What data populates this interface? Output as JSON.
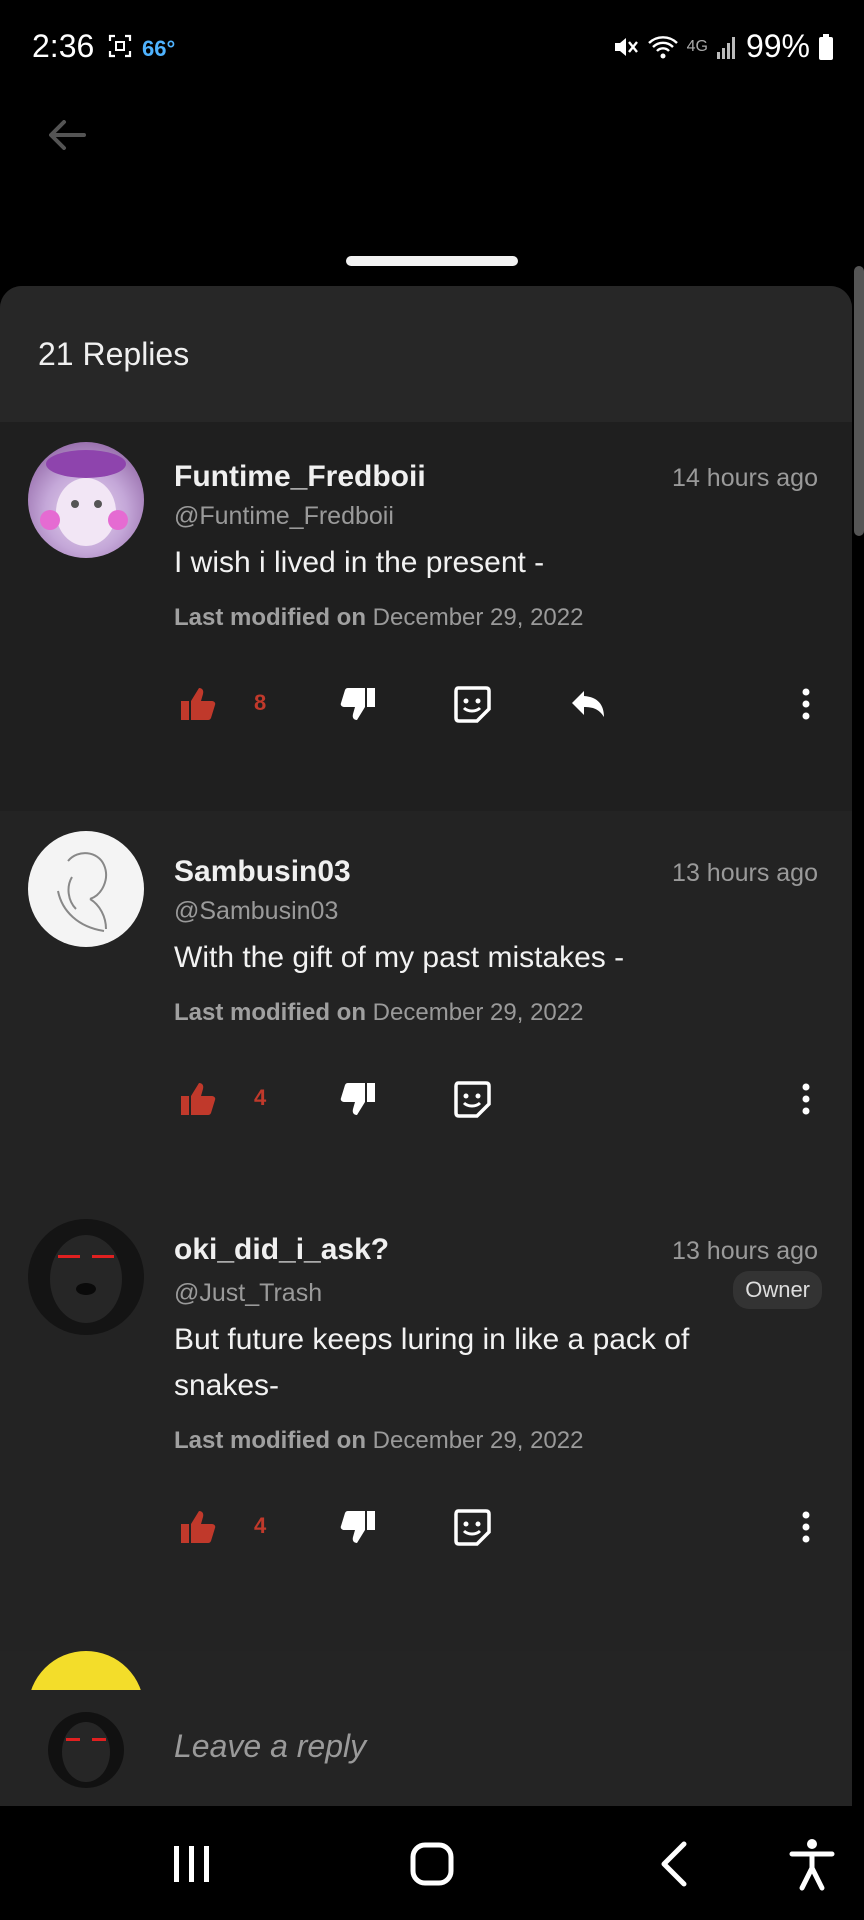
{
  "status_bar": {
    "time": "2:36",
    "temperature": "66°",
    "network": "4G",
    "battery": "99%"
  },
  "sheet": {
    "replies_count": "21 Replies"
  },
  "replies": [
    {
      "name": "Funtime_Fredboii",
      "handle": "@Funtime_Fredboii",
      "time": "14 hours ago",
      "text": "I wish i lived in the present -",
      "modified_label": "Last modified on",
      "modified_date": "December 29, 2022",
      "likes": "8"
    },
    {
      "name": "Sambusin03",
      "handle": "@Sambusin03",
      "time": "13 hours ago",
      "text": "With the gift of my past mistakes -",
      "modified_label": "Last modified on",
      "modified_date": "December 29, 2022",
      "likes": "4"
    },
    {
      "name": "oki_did_i_ask?",
      "handle": "@Just_Trash",
      "time": "13 hours ago",
      "badge": "Owner",
      "text": "But future keeps luring in like a pack of snakes-",
      "modified_label": "Last modified on",
      "modified_date": "December 29, 2022",
      "likes": "4"
    }
  ],
  "reply_input": {
    "placeholder": "Leave a reply"
  },
  "colors": {
    "like_accent": "#c0392b",
    "temp_accent": "#4fb3ff"
  },
  "icons": [
    "back-arrow-icon",
    "thumbs-up-icon",
    "thumbs-down-icon",
    "sticker-icon",
    "reply-icon",
    "more-vert-icon",
    "recent-apps-icon",
    "home-icon",
    "nav-back-icon",
    "accessibility-icon"
  ]
}
